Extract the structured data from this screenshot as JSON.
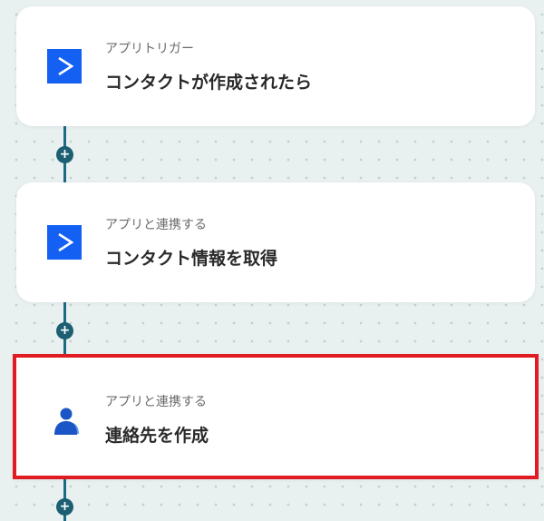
{
  "flow": {
    "steps": [
      {
        "type_label": "アプリトリガー",
        "title": "コンタクトが作成されたら",
        "icon": "activecampaign-icon",
        "selected": false
      },
      {
        "type_label": "アプリと連携する",
        "title": "コンタクト情報を取得",
        "icon": "activecampaign-icon",
        "selected": false
      },
      {
        "type_label": "アプリと連携する",
        "title": "連絡先を作成",
        "icon": "google-contacts-icon",
        "selected": true
      }
    ],
    "add_step_symbol": "+"
  },
  "colors": {
    "canvas_background": "#e9f0f0",
    "canvas_dots": "#c3cfd0",
    "connector": "#1c6b80",
    "add_button": "#1c5f73",
    "card_background": "#ffffff",
    "selection_border": "#e11b22",
    "activecampaign_brand": "#1360f2",
    "google_contacts_dark": "#1a56c6",
    "google_contacts_light": "#5f97f5"
  }
}
